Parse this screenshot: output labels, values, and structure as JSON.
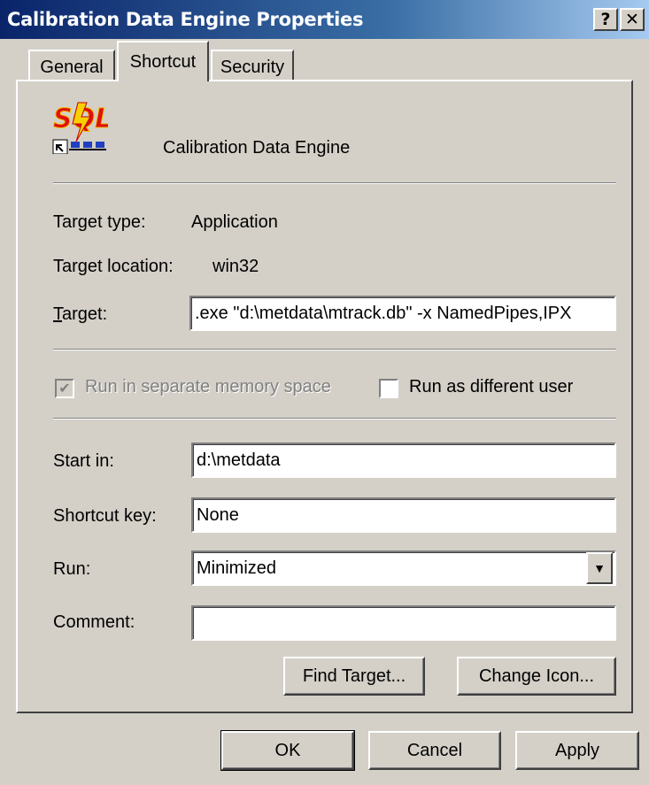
{
  "window": {
    "title": "Calibration Data Engine Properties",
    "help_button": "?",
    "close_button": "✕"
  },
  "tabs": [
    "General",
    "Shortcut",
    "Security"
  ],
  "active_tab": "Shortcut",
  "shortcut": {
    "name": "Calibration Data Engine",
    "icon_name": "app-shortcut-icon",
    "target_type_label": "Target type:",
    "target_type_value": "Application",
    "target_location_label": "Target location:",
    "target_location_value": "win32",
    "target_label": "Target:",
    "target_value": ".exe \"d:\\metdata\\mtrack.db\"  -x NamedPipes,IPX",
    "run_separate_label": "Run in separate memory space",
    "run_separate_checked": true,
    "run_separate_enabled": false,
    "run_as_label": "Run as different user",
    "run_as_checked": false,
    "start_in_label": "Start in:",
    "start_in_value": "d:\\metdata",
    "shortcut_key_label": "Shortcut key:",
    "shortcut_key_value": "None",
    "run_label": "Run:",
    "run_value": "Minimized",
    "comment_label": "Comment:",
    "comment_value": "",
    "find_target_label": "Find Target...",
    "change_icon_label": "Change Icon..."
  },
  "footer": {
    "ok_label": "OK",
    "cancel_label": "Cancel",
    "apply_label": "Apply"
  },
  "colors": {
    "title_start": "#0a246a",
    "title_end": "#a6caf0",
    "face": "#d4d0c8"
  }
}
